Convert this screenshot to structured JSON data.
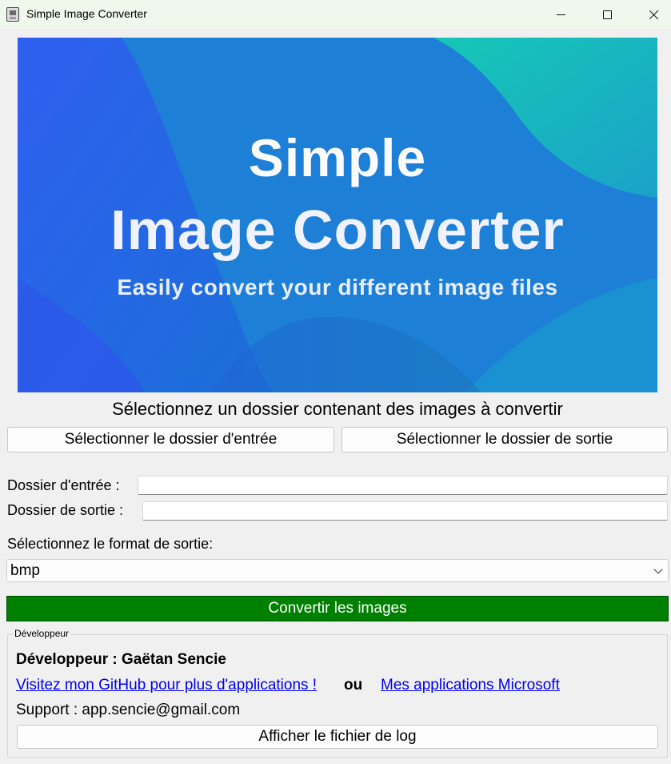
{
  "window": {
    "title": "Simple Image Converter"
  },
  "banner": {
    "line1": "Simple",
    "line2": "Image Converter",
    "tagline": "Easily convert your different image files",
    "colors": [
      "#2563ea",
      "#1c8ecf",
      "#18a9c6"
    ]
  },
  "main": {
    "instruction": "Sélectionnez un dossier contenant des images à convertir",
    "select_input_button": "Sélectionner le dossier d'entrée",
    "select_output_button": "Sélectionner le dossier de sortie",
    "input_folder_label": "Dossier d'entrée :",
    "input_folder_value": "",
    "output_folder_label": "Dossier de sortie :",
    "output_folder_value": "",
    "format_label": "Sélectionnez le format de sortie:",
    "format_selected": "bmp",
    "convert_button": "Convertir les images",
    "convert_button_color": "#008000"
  },
  "developer": {
    "group_title": "Développeur",
    "name": "Développeur : Gaëtan Sencie",
    "github_link": "Visitez mon GitHub pour plus d'applications !",
    "or": "ou",
    "microsoft_link": "Mes applications Microsoft",
    "support": "Support : app.sencie@gmail.com",
    "log_button": "Afficher le fichier de log"
  },
  "icons": [
    "app-icon",
    "minimize-icon",
    "maximize-icon",
    "close-icon",
    "chevron-down-icon"
  ]
}
